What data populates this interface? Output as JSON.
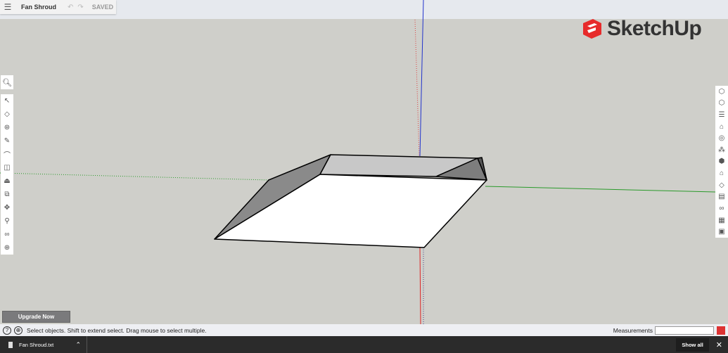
{
  "titlebar": {
    "title": "Fan Shroud",
    "status": "SAVED",
    "undo": "↶",
    "redo": "↷"
  },
  "logo": {
    "text": "SketchUp"
  },
  "upgrade_label": "Upgrade Now",
  "status": {
    "message": "Select objects. Shift to extend select. Drag mouse to select multiple.",
    "measurements_label": "Measurements",
    "measurements_value": ""
  },
  "downloads": {
    "file": "Fan Shroud.txt",
    "show_all": "Show all"
  },
  "left_tools": [
    "select",
    "eraser",
    "paint",
    "pencil",
    "arc",
    "rectangle",
    "push-pull",
    "offset",
    "move",
    "rotate",
    "tape-measure",
    "orbit"
  ],
  "right_tools": [
    "components",
    "materials",
    "styles",
    "layers",
    "scenes",
    "entity-info",
    "outliner",
    "tags",
    "instructor",
    "display",
    "model-info",
    "solid-tools"
  ]
}
